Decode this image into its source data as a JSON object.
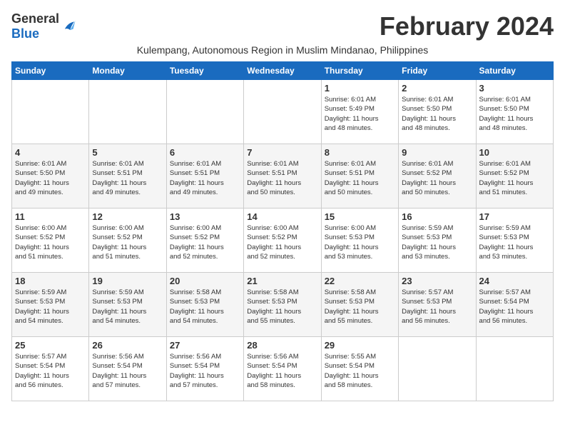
{
  "logo": {
    "general": "General",
    "blue": "Blue"
  },
  "title": "February 2024",
  "subtitle": "Kulempang, Autonomous Region in Muslim Mindanao, Philippines",
  "days_header": [
    "Sunday",
    "Monday",
    "Tuesday",
    "Wednesday",
    "Thursday",
    "Friday",
    "Saturday"
  ],
  "weeks": [
    {
      "shaded": false,
      "days": [
        {
          "num": "",
          "info": ""
        },
        {
          "num": "",
          "info": ""
        },
        {
          "num": "",
          "info": ""
        },
        {
          "num": "",
          "info": ""
        },
        {
          "num": "1",
          "info": "Sunrise: 6:01 AM\nSunset: 5:49 PM\nDaylight: 11 hours\nand 48 minutes."
        },
        {
          "num": "2",
          "info": "Sunrise: 6:01 AM\nSunset: 5:50 PM\nDaylight: 11 hours\nand 48 minutes."
        },
        {
          "num": "3",
          "info": "Sunrise: 6:01 AM\nSunset: 5:50 PM\nDaylight: 11 hours\nand 48 minutes."
        }
      ]
    },
    {
      "shaded": true,
      "days": [
        {
          "num": "4",
          "info": "Sunrise: 6:01 AM\nSunset: 5:50 PM\nDaylight: 11 hours\nand 49 minutes."
        },
        {
          "num": "5",
          "info": "Sunrise: 6:01 AM\nSunset: 5:51 PM\nDaylight: 11 hours\nand 49 minutes."
        },
        {
          "num": "6",
          "info": "Sunrise: 6:01 AM\nSunset: 5:51 PM\nDaylight: 11 hours\nand 49 minutes."
        },
        {
          "num": "7",
          "info": "Sunrise: 6:01 AM\nSunset: 5:51 PM\nDaylight: 11 hours\nand 50 minutes."
        },
        {
          "num": "8",
          "info": "Sunrise: 6:01 AM\nSunset: 5:51 PM\nDaylight: 11 hours\nand 50 minutes."
        },
        {
          "num": "9",
          "info": "Sunrise: 6:01 AM\nSunset: 5:52 PM\nDaylight: 11 hours\nand 50 minutes."
        },
        {
          "num": "10",
          "info": "Sunrise: 6:01 AM\nSunset: 5:52 PM\nDaylight: 11 hours\nand 51 minutes."
        }
      ]
    },
    {
      "shaded": false,
      "days": [
        {
          "num": "11",
          "info": "Sunrise: 6:00 AM\nSunset: 5:52 PM\nDaylight: 11 hours\nand 51 minutes."
        },
        {
          "num": "12",
          "info": "Sunrise: 6:00 AM\nSunset: 5:52 PM\nDaylight: 11 hours\nand 51 minutes."
        },
        {
          "num": "13",
          "info": "Sunrise: 6:00 AM\nSunset: 5:52 PM\nDaylight: 11 hours\nand 52 minutes."
        },
        {
          "num": "14",
          "info": "Sunrise: 6:00 AM\nSunset: 5:52 PM\nDaylight: 11 hours\nand 52 minutes."
        },
        {
          "num": "15",
          "info": "Sunrise: 6:00 AM\nSunset: 5:53 PM\nDaylight: 11 hours\nand 53 minutes."
        },
        {
          "num": "16",
          "info": "Sunrise: 5:59 AM\nSunset: 5:53 PM\nDaylight: 11 hours\nand 53 minutes."
        },
        {
          "num": "17",
          "info": "Sunrise: 5:59 AM\nSunset: 5:53 PM\nDaylight: 11 hours\nand 53 minutes."
        }
      ]
    },
    {
      "shaded": true,
      "days": [
        {
          "num": "18",
          "info": "Sunrise: 5:59 AM\nSunset: 5:53 PM\nDaylight: 11 hours\nand 54 minutes."
        },
        {
          "num": "19",
          "info": "Sunrise: 5:59 AM\nSunset: 5:53 PM\nDaylight: 11 hours\nand 54 minutes."
        },
        {
          "num": "20",
          "info": "Sunrise: 5:58 AM\nSunset: 5:53 PM\nDaylight: 11 hours\nand 54 minutes."
        },
        {
          "num": "21",
          "info": "Sunrise: 5:58 AM\nSunset: 5:53 PM\nDaylight: 11 hours\nand 55 minutes."
        },
        {
          "num": "22",
          "info": "Sunrise: 5:58 AM\nSunset: 5:53 PM\nDaylight: 11 hours\nand 55 minutes."
        },
        {
          "num": "23",
          "info": "Sunrise: 5:57 AM\nSunset: 5:53 PM\nDaylight: 11 hours\nand 56 minutes."
        },
        {
          "num": "24",
          "info": "Sunrise: 5:57 AM\nSunset: 5:54 PM\nDaylight: 11 hours\nand 56 minutes."
        }
      ]
    },
    {
      "shaded": false,
      "days": [
        {
          "num": "25",
          "info": "Sunrise: 5:57 AM\nSunset: 5:54 PM\nDaylight: 11 hours\nand 56 minutes."
        },
        {
          "num": "26",
          "info": "Sunrise: 5:56 AM\nSunset: 5:54 PM\nDaylight: 11 hours\nand 57 minutes."
        },
        {
          "num": "27",
          "info": "Sunrise: 5:56 AM\nSunset: 5:54 PM\nDaylight: 11 hours\nand 57 minutes."
        },
        {
          "num": "28",
          "info": "Sunrise: 5:56 AM\nSunset: 5:54 PM\nDaylight: 11 hours\nand 58 minutes."
        },
        {
          "num": "29",
          "info": "Sunrise: 5:55 AM\nSunset: 5:54 PM\nDaylight: 11 hours\nand 58 minutes."
        },
        {
          "num": "",
          "info": ""
        },
        {
          "num": "",
          "info": ""
        }
      ]
    }
  ]
}
